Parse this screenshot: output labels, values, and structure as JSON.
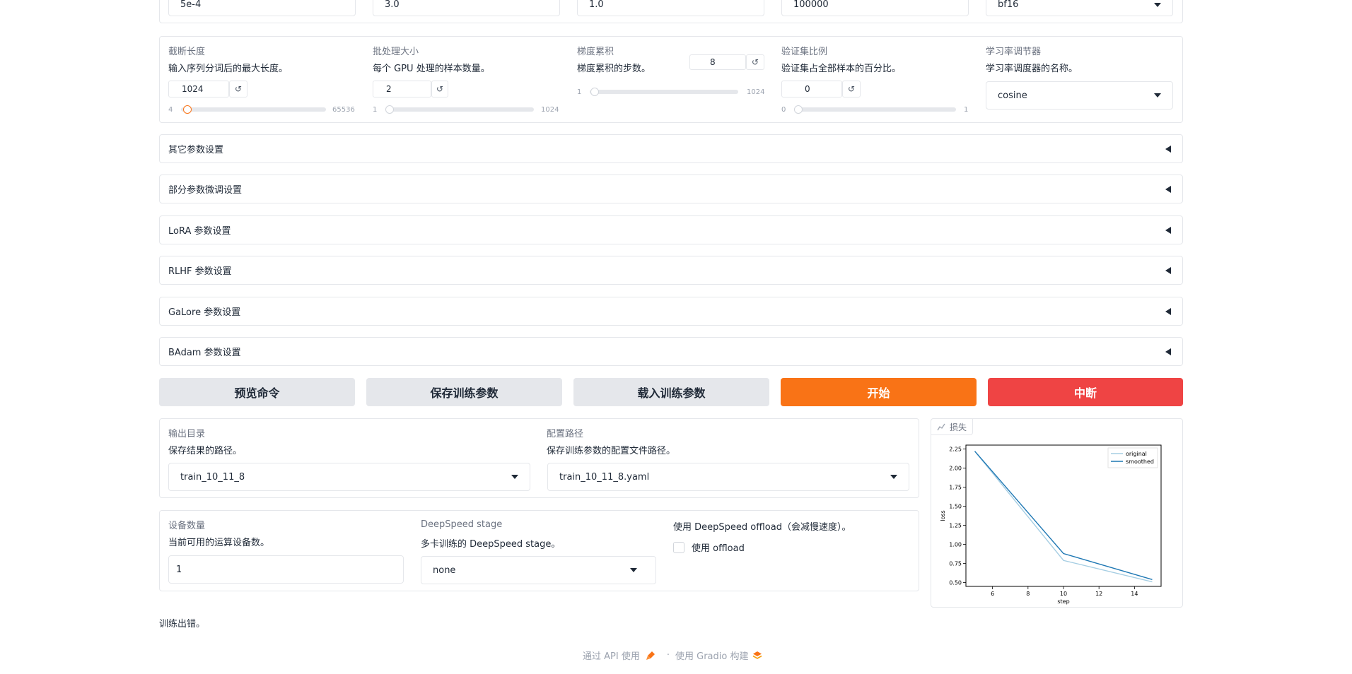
{
  "top_row": [
    {
      "value": "5e-4"
    },
    {
      "value": "3.0"
    },
    {
      "value": "1.0"
    },
    {
      "value": "100000"
    },
    {
      "value": "bf16"
    }
  ],
  "cutoff": {
    "label": "截断长度",
    "info": "输入序列分词后的最大长度。",
    "value": "1024",
    "min": "4",
    "max": "65536",
    "reset": "↺",
    "fraction": 0.0156
  },
  "batch": {
    "label": "批处理大小",
    "info": "每个 GPU 处理的样本数量。",
    "value": "2",
    "min": "1",
    "max": "1024",
    "reset": "↺",
    "fraction": 0.001
  },
  "grad_accum": {
    "label": "梯度累积",
    "info": "梯度累积的步数。",
    "value": "8",
    "min": "1",
    "max": "1024",
    "reset": "↺",
    "fraction": 0.007
  },
  "val_size": {
    "label": "验证集比例",
    "info": "验证集占全部样本的百分比。",
    "value": "0",
    "min": "0",
    "max": "1",
    "reset": "↺",
    "fraction": 0.0
  },
  "scheduler": {
    "label": "学习率调节器",
    "info": "学习率调度器的名称。",
    "value": "cosine"
  },
  "accordions": [
    {
      "label": "其它参数设置"
    },
    {
      "label": "部分参数微调设置"
    },
    {
      "label": "LoRA 参数设置"
    },
    {
      "label": "RLHF 参数设置"
    },
    {
      "label": "GaLore 参数设置"
    },
    {
      "label": "BAdam 参数设置"
    }
  ],
  "buttons": {
    "preview": "预览命令",
    "save": "保存训练参数",
    "load": "载入训练参数",
    "start": "开始",
    "stop": "中断"
  },
  "output_dir": {
    "label": "输出目录",
    "info": "保存结果的路径。",
    "value": "train_10_11_8"
  },
  "config_path": {
    "label": "配置路径",
    "info": "保存训练参数的配置文件路径。",
    "value": "train_10_11_8.yaml"
  },
  "devices": {
    "label": "设备数量",
    "info": "当前可用的运算设备数。",
    "value": "1"
  },
  "ds_stage": {
    "label": "DeepSpeed stage",
    "info": "多卡训练的 DeepSpeed stage。",
    "value": "none"
  },
  "ds_offload": {
    "label": "使用 DeepSpeed offload（会减慢速度）。",
    "checkbox": "使用 offload",
    "checked": false
  },
  "plot_tab": {
    "label": "损失"
  },
  "output_text": "训练出错。",
  "footer": {
    "api": "通过 API 使用",
    "sep": "·",
    "built": "使用 Gradio 构建"
  },
  "colors": {
    "primary": "#f97316",
    "stop": "#ef4444",
    "original": "#a6cee3",
    "smoothed": "#1f78b4"
  },
  "chart_data": {
    "type": "line",
    "xlabel": "step",
    "ylabel": "loss",
    "xlim": [
      4.5,
      15.5
    ],
    "ylim": [
      0.45,
      2.3
    ],
    "xticks": [
      "6",
      "8",
      "10",
      "12",
      "14"
    ],
    "yticks": [
      "0.50",
      "0.75",
      "1.00",
      "1.25",
      "1.50",
      "1.75",
      "2.00",
      "2.25"
    ],
    "legend": "top-right",
    "series": [
      {
        "name": "original",
        "x": [
          5,
          10,
          15
        ],
        "y": [
          2.22,
          0.79,
          0.51
        ]
      },
      {
        "name": "smoothed",
        "x": [
          5,
          10,
          15
        ],
        "y": [
          2.22,
          0.88,
          0.54
        ]
      }
    ]
  }
}
